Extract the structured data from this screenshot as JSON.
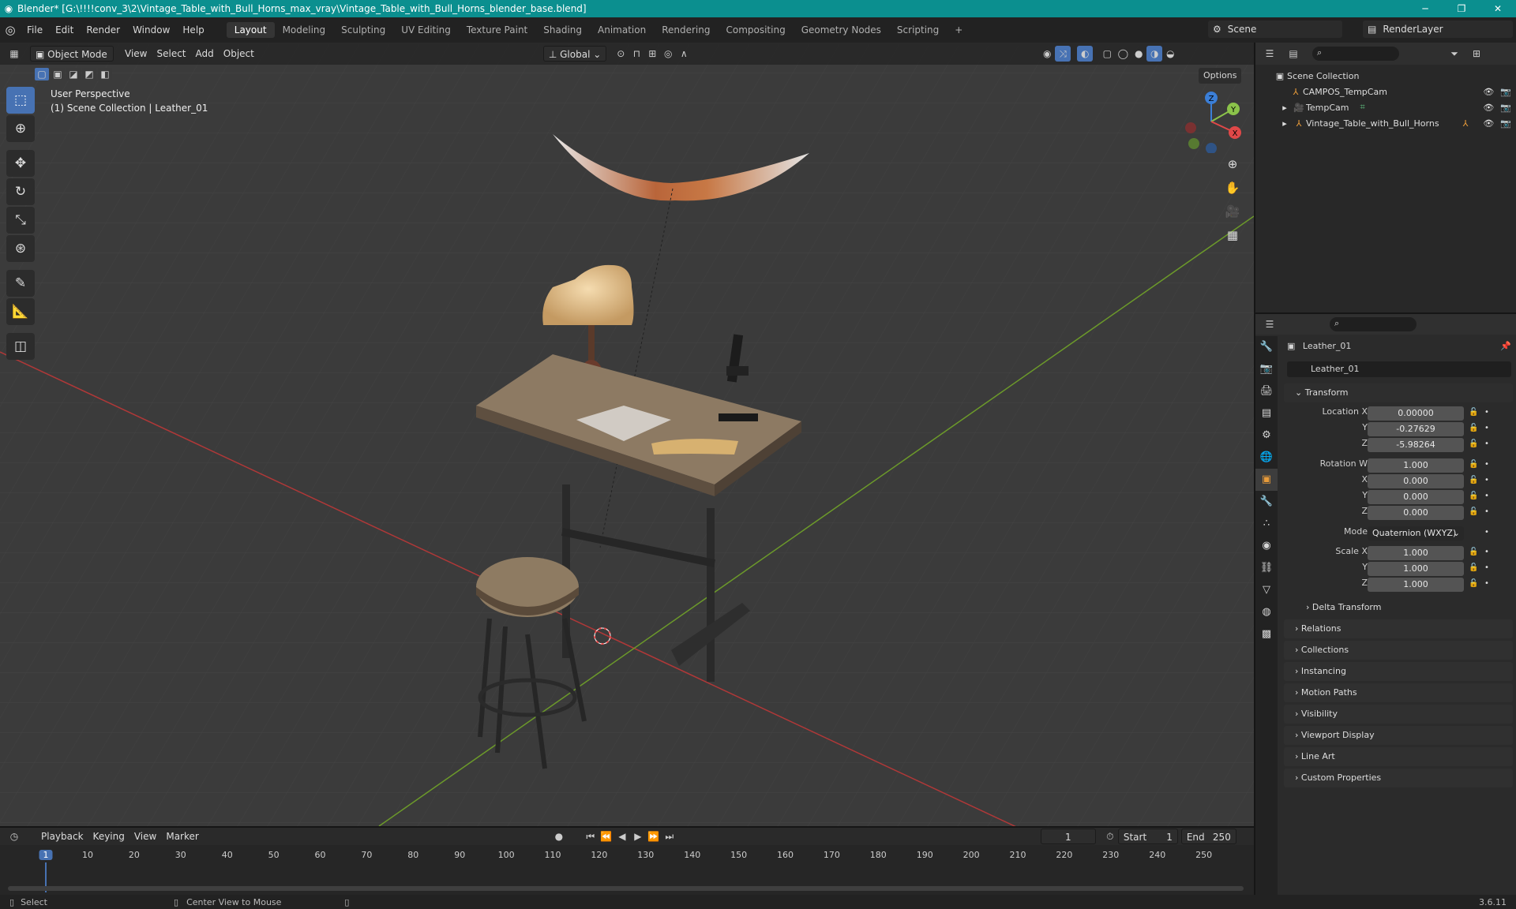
{
  "window": {
    "title": "Blender* [G:\\!!!!conv_3\\2\\Vintage_Table_with_Bull_Horns_max_vray\\Vintage_Table_with_Bull_Horns_blender_base.blend]",
    "minimize": "─",
    "maximize": "❐",
    "close": "✕"
  },
  "menu": [
    "File",
    "Edit",
    "Render",
    "Window",
    "Help"
  ],
  "workspaces": [
    "Layout",
    "Modeling",
    "Sculpting",
    "UV Editing",
    "Texture Paint",
    "Shading",
    "Animation",
    "Rendering",
    "Compositing",
    "Geometry Nodes",
    "Scripting",
    "+"
  ],
  "active_workspace": "Layout",
  "scene": {
    "name": "Scene",
    "view_layer": "RenderLayer"
  },
  "viewport": {
    "mode": "Object Mode",
    "menus": [
      "View",
      "Select",
      "Add",
      "Object"
    ],
    "orientation": "Global",
    "options": "Options",
    "info_line1": "User Perspective",
    "info_line2": "(1) Scene Collection | Leather_01",
    "gizmo": {
      "x": "X",
      "y": "Y",
      "z": "Z"
    }
  },
  "outliner": {
    "root": "Scene Collection",
    "items": [
      {
        "name": "CAMPOS_TempCam"
      },
      {
        "name": "TempCam"
      },
      {
        "name": "Vintage_Table_with_Bull_Horns"
      }
    ]
  },
  "properties": {
    "object_name": "Leather_01",
    "data_name": "Leather_01",
    "transform_title": "Transform",
    "location": {
      "label_x": "Location X",
      "label_y": "Y",
      "label_z": "Z",
      "x": "0.00000",
      "y": "-0.27629",
      "z": "-5.98264"
    },
    "rotation": {
      "label_w": "Rotation W",
      "label_x": "X",
      "label_y": "Y",
      "label_z": "Z",
      "w": "1.000",
      "x": "0.000",
      "y": "0.000",
      "z": "0.000"
    },
    "mode_label": "Mode",
    "mode": "Quaternion (WXYZ)",
    "scale": {
      "label_x": "Scale X",
      "label_y": "Y",
      "label_z": "Z",
      "x": "1.000",
      "y": "1.000",
      "z": "1.000"
    },
    "delta": "Delta Transform",
    "panels": [
      "Relations",
      "Collections",
      "Instancing",
      "Motion Paths",
      "Visibility",
      "Viewport Display",
      "Line Art",
      "Custom Properties"
    ]
  },
  "timeline": {
    "menus": [
      "Playback",
      "Keying",
      "View",
      "Marker"
    ],
    "current_frame": "1",
    "start_label": "Start",
    "start": "1",
    "end_label": "End",
    "end": "250",
    "ticks": [
      "1",
      "10",
      "20",
      "30",
      "40",
      "50",
      "60",
      "70",
      "80",
      "90",
      "100",
      "110",
      "120",
      "130",
      "140",
      "150",
      "160",
      "170",
      "180",
      "190",
      "200",
      "210",
      "220",
      "230",
      "240",
      "250"
    ]
  },
  "status": {
    "select": "Select",
    "center": "Center View to Mouse",
    "version": "3.6.11"
  },
  "colors": {
    "accent": "#4772b3",
    "titlebar": "#0b8f8f",
    "x_axis": "#c33c3c",
    "y_axis": "#6a9b2c"
  }
}
